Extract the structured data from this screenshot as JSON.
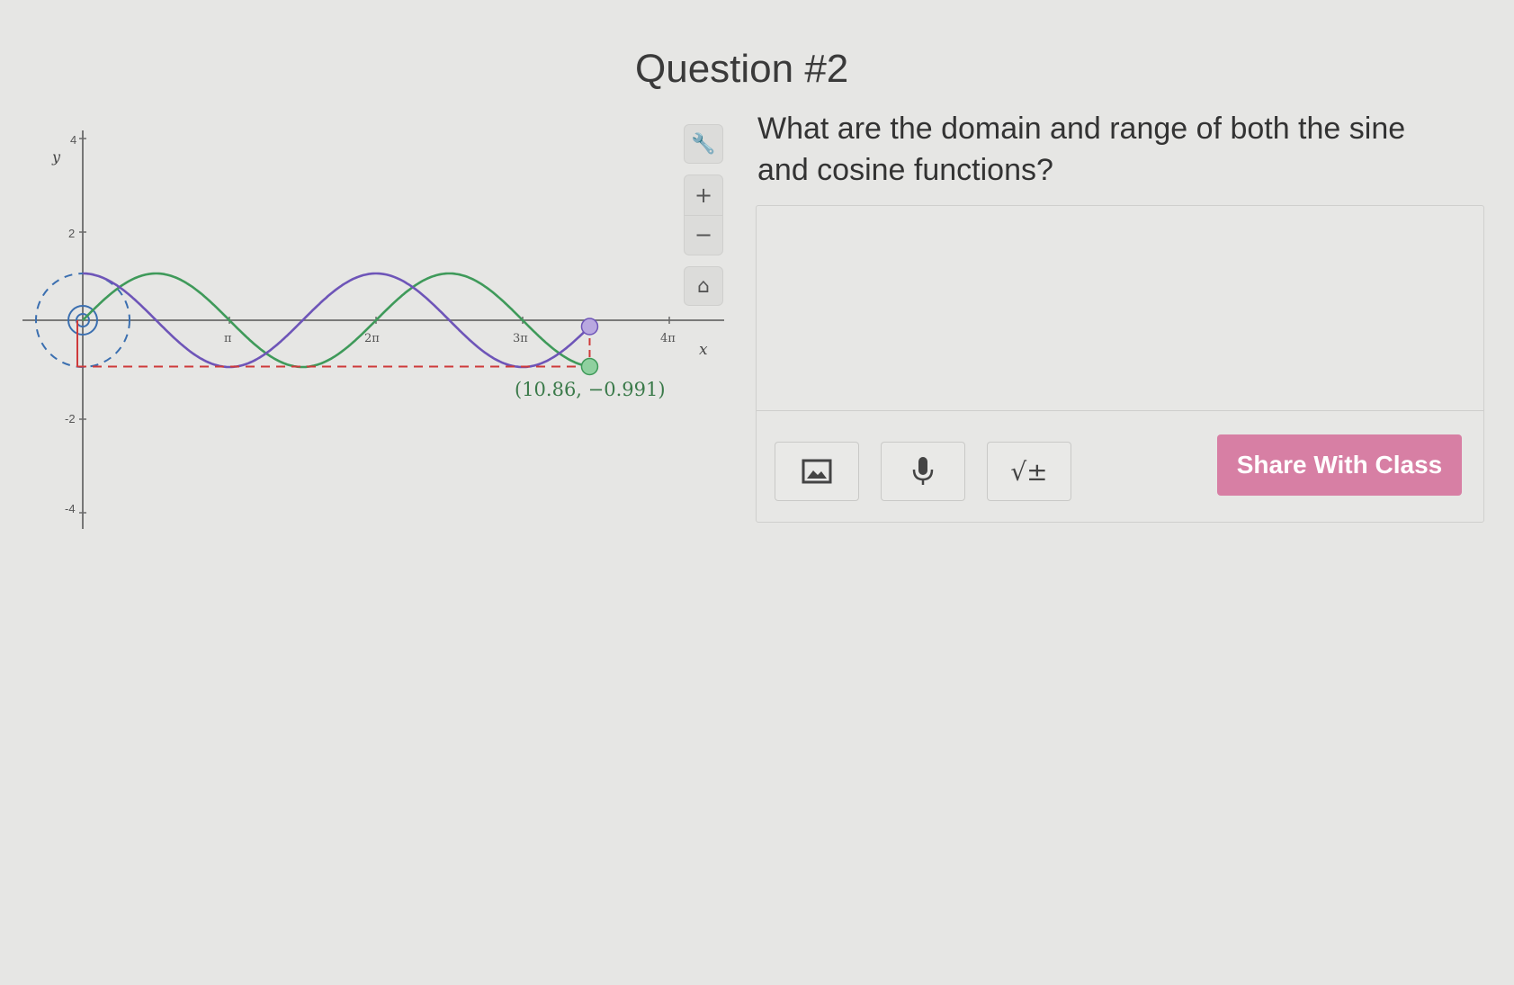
{
  "question": {
    "title": "Question #2",
    "prompt": "What are the domain and range of both the sine and cosine functions?"
  },
  "graph": {
    "y_axis_label": "y",
    "x_axis_label": "x",
    "y_ticks": [
      "4",
      "2",
      "-2",
      "-4"
    ],
    "x_ticks": [
      "π",
      "2π",
      "3π",
      "4π"
    ],
    "point_label": "(10.86, −0.991)",
    "point": {
      "x": 10.86,
      "y": -0.991
    },
    "colors": {
      "sine": "#3f9a5a",
      "cosine": "#6e55b8",
      "circle": "#3b6fb0",
      "marker_line": "#cf3a3a",
      "point_label": "#3b7a4a"
    },
    "tools": {
      "settings_icon": "wrench-icon",
      "zoom_in": "+",
      "zoom_out": "−",
      "home_icon": "home-icon"
    }
  },
  "answer": {
    "placeholder": "",
    "image_icon": "image-icon",
    "mic_icon": "microphone-icon",
    "math_label": "√±",
    "share_label": "Share With Class",
    "share_color": "#d77fa4"
  }
}
